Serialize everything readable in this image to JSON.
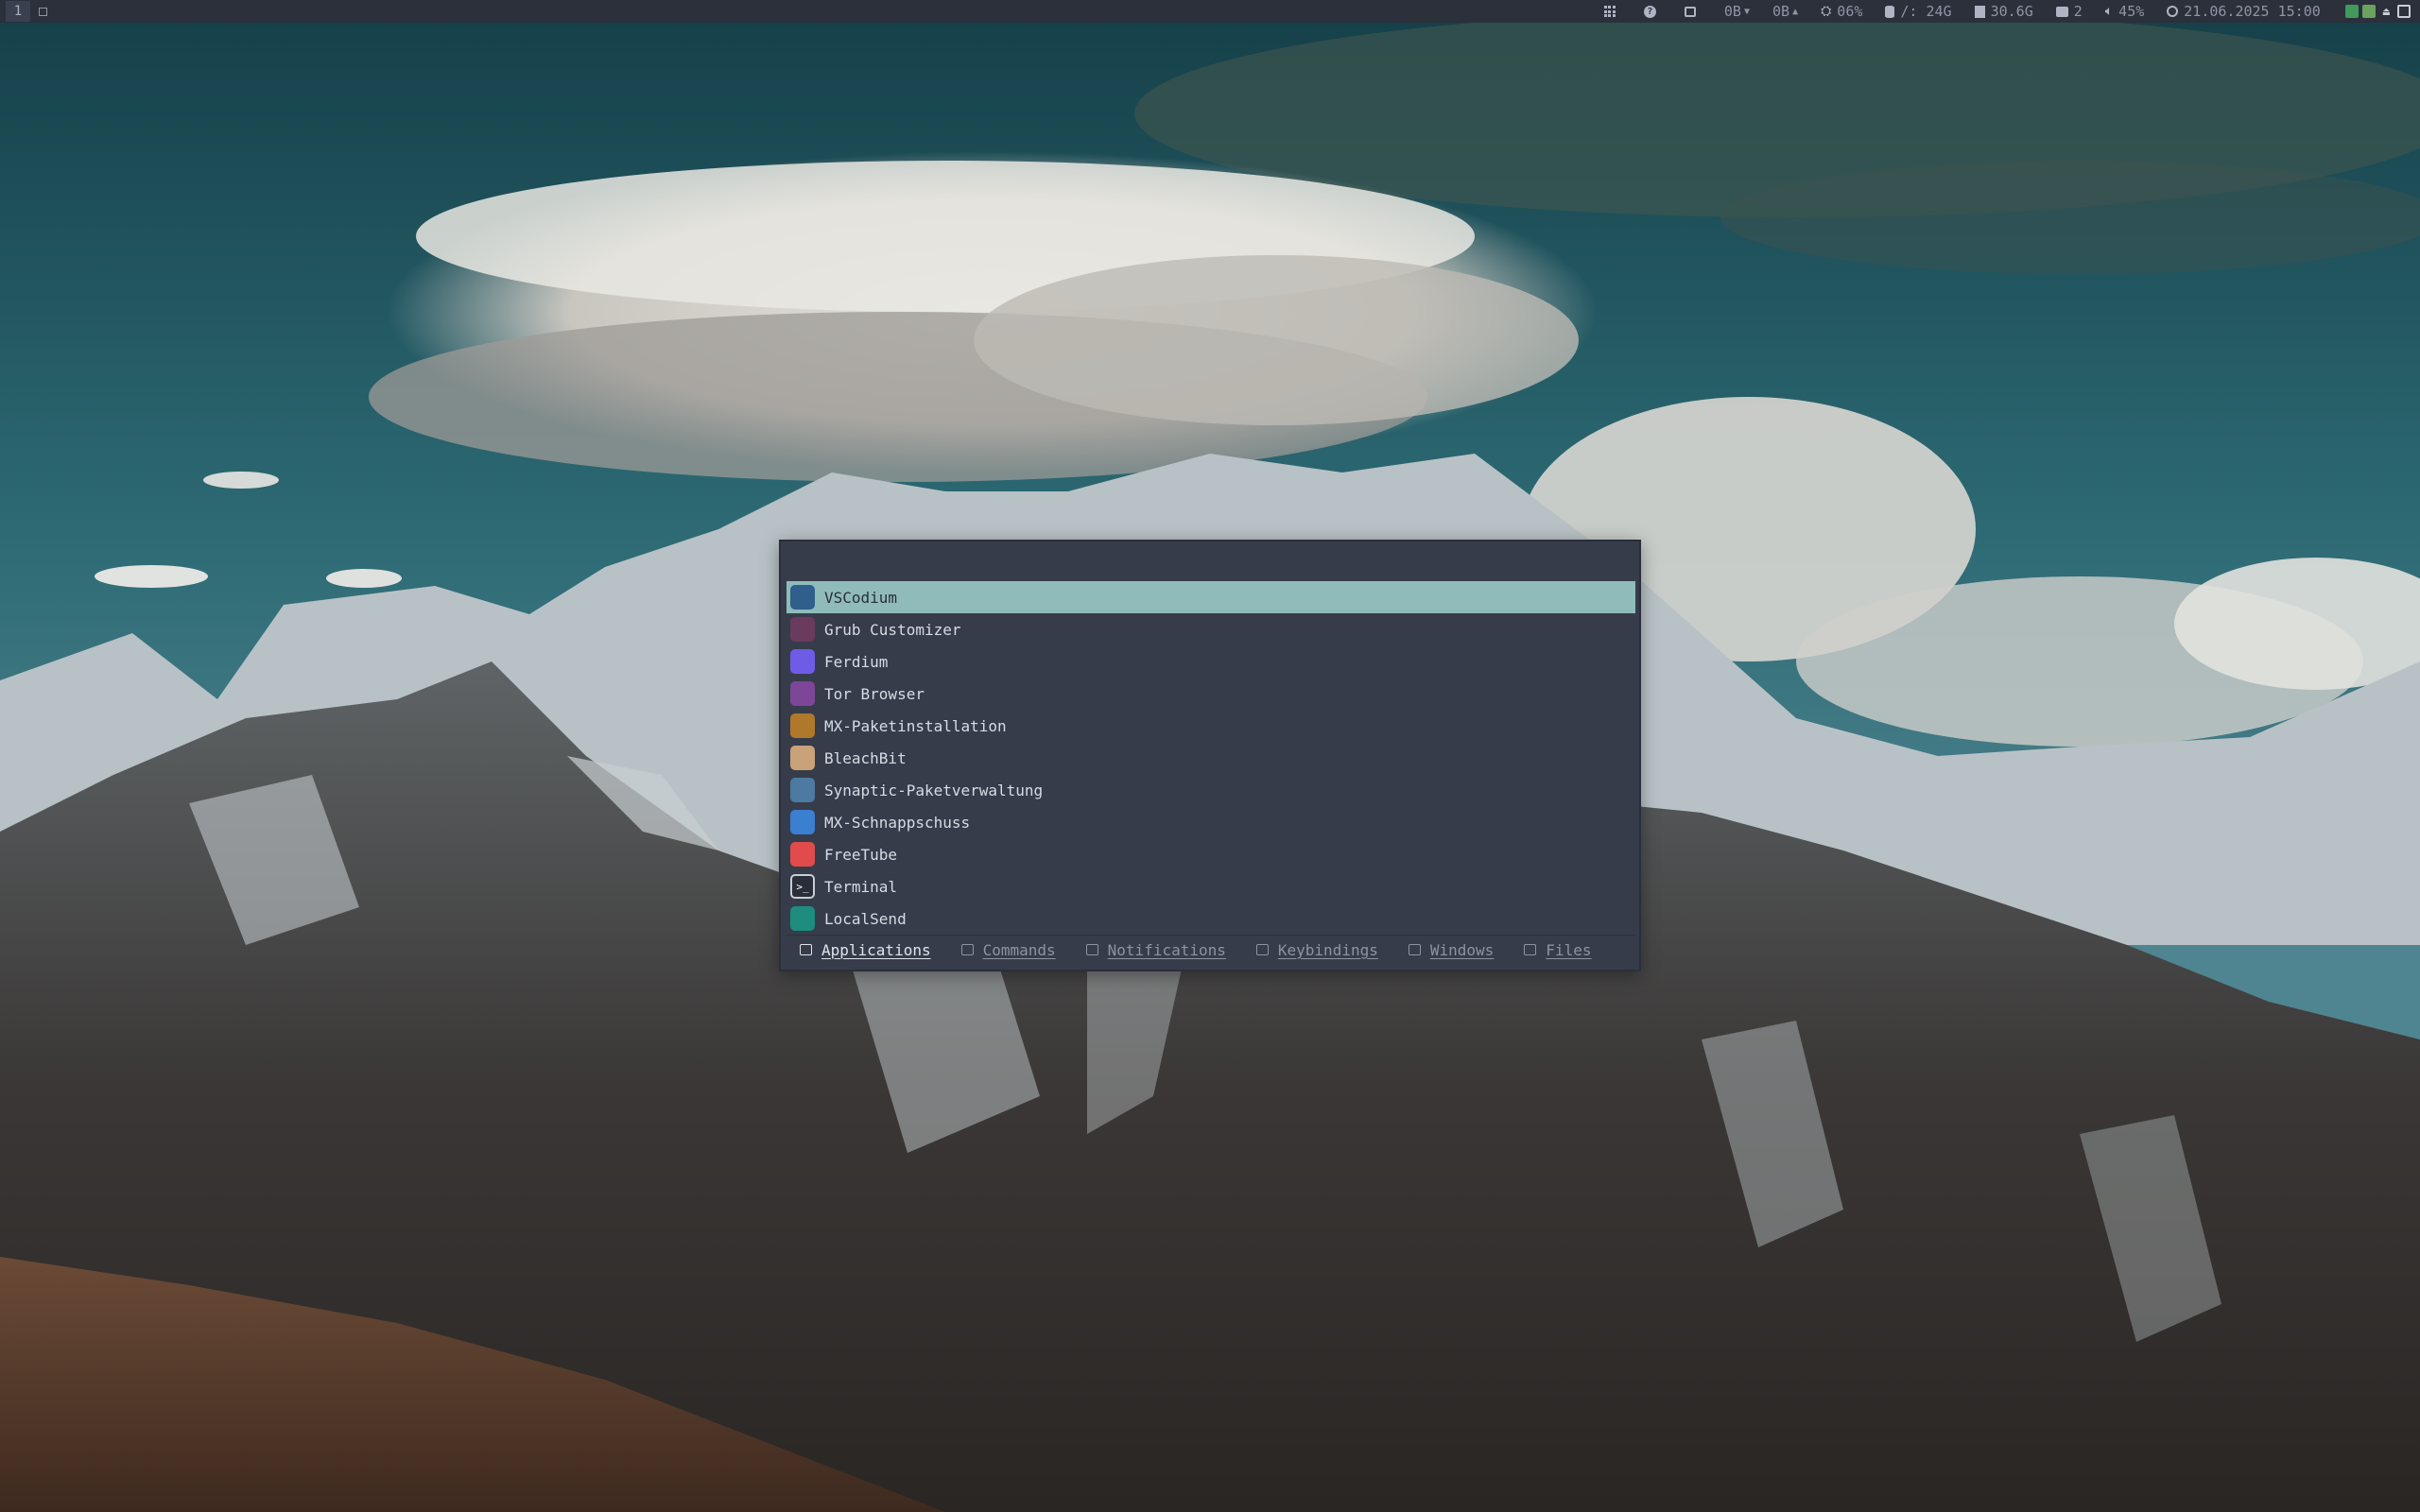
{
  "topbar": {
    "workspace_label": "1",
    "modules": [
      {
        "name": "apps-grid-icon",
        "text": ""
      },
      {
        "name": "help-icon",
        "text": ""
      },
      {
        "name": "screen-icon",
        "text": ""
      },
      {
        "name": "download-speed",
        "text": "0B"
      },
      {
        "name": "upload-speed",
        "text": "0B"
      },
      {
        "name": "cpu-usage",
        "text": "06%"
      },
      {
        "name": "disk-usage",
        "text": "/: 24G"
      },
      {
        "name": "memory-usage",
        "text": "30.6G"
      },
      {
        "name": "notifications-count",
        "text": "2"
      },
      {
        "name": "volume-level",
        "text": "45%"
      },
      {
        "name": "datetime",
        "text": "21.06.2025 15:00"
      }
    ]
  },
  "launcher": {
    "search_text": "",
    "apps": [
      {
        "label": "VSCodium",
        "icon": "vscodium-icon",
        "color": "#2f5f8a",
        "selected": true
      },
      {
        "label": "Grub Customizer",
        "icon": "grub-customizer-icon",
        "color": "#6b3b5e",
        "selected": false
      },
      {
        "label": "Ferdium",
        "icon": "ferdium-icon",
        "color": "#6e5ce6",
        "selected": false
      },
      {
        "label": "Tor Browser",
        "icon": "tor-browser-icon",
        "color": "#7d4698",
        "selected": false
      },
      {
        "label": "MX-Paketinstallation",
        "icon": "mx-package-installer-icon",
        "color": "#b0782a",
        "selected": false
      },
      {
        "label": "BleachBit",
        "icon": "bleachbit-icon",
        "color": "#c9a27a",
        "selected": false
      },
      {
        "label": "Synaptic-Paketverwaltung",
        "icon": "synaptic-icon",
        "color": "#4c7aa0",
        "selected": false
      },
      {
        "label": "MX-Schnappschuss",
        "icon": "mx-snapshot-icon",
        "color": "#3a7fd0",
        "selected": false
      },
      {
        "label": "FreeTube",
        "icon": "freetube-icon",
        "color": "#e24b4b",
        "selected": false
      },
      {
        "label": "Terminal",
        "icon": "terminal-icon",
        "color": "#2a2e39",
        "selected": false
      },
      {
        "label": "LocalSend",
        "icon": "localsend-icon",
        "color": "#1e8c7e",
        "selected": false
      }
    ],
    "modes": [
      {
        "label": "Applications",
        "active": true
      },
      {
        "label": "Commands",
        "active": false
      },
      {
        "label": "Notifications",
        "active": false
      },
      {
        "label": "Keybindings",
        "active": false
      },
      {
        "label": "Windows",
        "active": false
      },
      {
        "label": "Files",
        "active": false
      }
    ]
  },
  "colors": {
    "bar_bg": "#2b303b",
    "launcher_bg": "#373c4b",
    "selection": "#8fbcbb"
  }
}
